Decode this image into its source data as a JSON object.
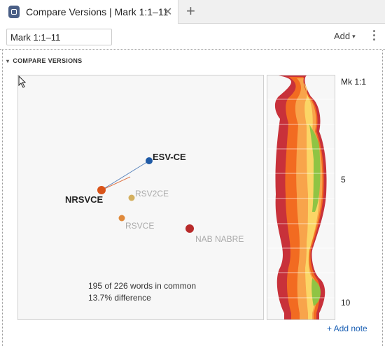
{
  "tab": {
    "title": "Compare Versions | Mark 1:1–11",
    "close": "✕",
    "new_tab": "+"
  },
  "toolbar": {
    "reference_value": "Mark 1:1–11",
    "add_label": "Add",
    "add_caret": "▾"
  },
  "section": {
    "caret": "▾",
    "title": "COMPARE VERSIONS"
  },
  "versions": [
    {
      "label": "ESV-CE",
      "color": "#1f5aa6",
      "emphasis": true
    },
    {
      "label": "NRSVCE",
      "color": "#d9541a",
      "emphasis": true
    },
    {
      "label": "RSV2CE",
      "color": "#d4b060",
      "emphasis": false
    },
    {
      "label": "RSVCE",
      "color": "#e08a3c",
      "emphasis": false
    },
    {
      "label": "NAB NABRE",
      "color": "#b82a2a",
      "emphasis": false
    }
  ],
  "summary": {
    "common": "195 of 226 words in common",
    "difference": "13.7% difference"
  },
  "stream_colors": [
    "#c8313a",
    "#f26b21",
    "#f8a44b",
    "#fbd566",
    "#8fc444"
  ],
  "reference_labels": {
    "start": "Mk 1:1",
    "mid": "5",
    "end": "10"
  },
  "add_note": "+ Add note"
}
